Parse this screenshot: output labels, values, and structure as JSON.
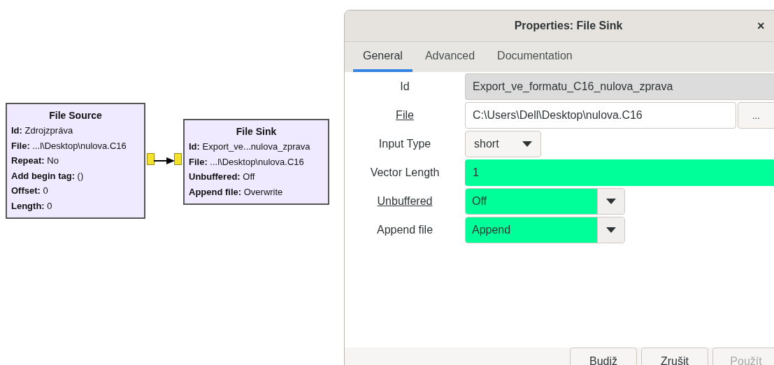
{
  "canvas": {
    "blocks": [
      {
        "title": "File Source",
        "has_input": false,
        "has_output": true,
        "params": [
          {
            "name": "Id:",
            "value": "Zdrojzpráva"
          },
          {
            "name": "File:",
            "value": "...l\\Desktop\\nulova.C16"
          },
          {
            "name": "Repeat:",
            "value": "No"
          },
          {
            "name": "Add begin tag:",
            "value": "()"
          },
          {
            "name": "Offset:",
            "value": "0"
          },
          {
            "name": "Length:",
            "value": "0"
          }
        ]
      },
      {
        "title": "File Sink",
        "has_input": true,
        "has_output": false,
        "params": [
          {
            "name": "Id:",
            "value": "Export_ve...nulova_zprava"
          },
          {
            "name": "File:",
            "value": "...l\\Desktop\\nulova.C16"
          },
          {
            "name": "Unbuffered:",
            "value": "Off"
          },
          {
            "name": "Append file:",
            "value": "Overwrite"
          }
        ]
      }
    ]
  },
  "dialog": {
    "title": "Properties: File Sink",
    "close": "×",
    "tabs": [
      {
        "label": "General",
        "selected": true
      },
      {
        "label": "Advanced",
        "selected": false
      },
      {
        "label": "Documentation",
        "selected": false
      }
    ],
    "fields": [
      {
        "label": "Id",
        "kind": "entry",
        "value": "Export_ve_formatu_C16_nulova_zprava",
        "underlined": false,
        "highlighted": false,
        "readonly": true
      },
      {
        "label": "File",
        "kind": "file",
        "value": "C:\\Users\\Dell\\Desktop\\nulova.C16",
        "button": "...",
        "underlined": true,
        "highlighted": false
      },
      {
        "label": "Input Type",
        "kind": "menu",
        "value": "short",
        "underlined": false,
        "highlighted": false
      },
      {
        "label": "Vector Length",
        "kind": "entry",
        "value": "1",
        "underlined": false,
        "highlighted": true,
        "readonly": false
      },
      {
        "label": "Unbuffered",
        "kind": "combo",
        "value": "Off",
        "underlined": true,
        "highlighted": true
      },
      {
        "label": "Append file",
        "kind": "combo",
        "value": "Append",
        "underlined": false,
        "highlighted": true
      }
    ],
    "buttons": [
      {
        "label": "Budiž",
        "disabled": false
      },
      {
        "label": "Zrušit",
        "disabled": false
      },
      {
        "label": "Použít",
        "disabled": true
      }
    ]
  }
}
